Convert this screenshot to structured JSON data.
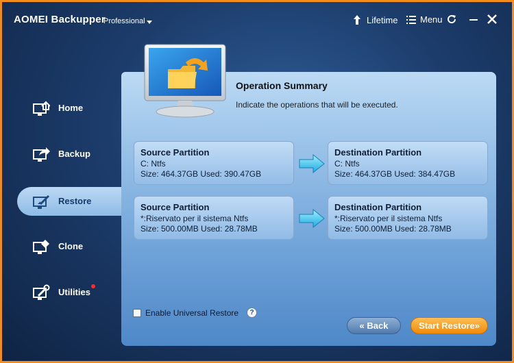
{
  "window": {
    "app_title": "AOMEI Backupper",
    "edition": "Professional",
    "lifetime_label": "Lifetime",
    "menu_label": "Menu",
    "border_color": "#f28c1a"
  },
  "sidebar": {
    "items": [
      {
        "label": "Home",
        "icon": "home-icon"
      },
      {
        "label": "Backup",
        "icon": "backup-icon"
      },
      {
        "label": "Restore",
        "icon": "restore-icon",
        "active": true
      },
      {
        "label": "Clone",
        "icon": "clone-icon"
      },
      {
        "label": "Utilities",
        "icon": "utilities-icon",
        "badge": true
      }
    ]
  },
  "summary": {
    "title": "Operation Summary",
    "subtitle": "Indicate the operations that will be executed."
  },
  "operations": [
    {
      "source": {
        "title": "Source Partition",
        "name": "C: Ntfs",
        "size": "Size: 464.37GB  Used: 390.47GB"
      },
      "destination": {
        "title": "Destination Partition",
        "name": "C: Ntfs",
        "size": "Size: 464.37GB  Used: 384.47GB"
      }
    },
    {
      "source": {
        "title": "Source Partition",
        "name": "*:Riservato per il sistema Ntfs",
        "size": "Size: 500.00MB  Used: 28.78MB"
      },
      "destination": {
        "title": "Destination Partition",
        "name": "*:Riservato per il sistema Ntfs",
        "size": "Size: 500.00MB  Used: 28.78MB"
      }
    }
  ],
  "options": {
    "universal_restore_label": "Enable Universal Restore",
    "universal_restore_checked": false,
    "help_glyph": "?"
  },
  "buttons": {
    "back": "« Back",
    "start": "Start Restore»"
  }
}
